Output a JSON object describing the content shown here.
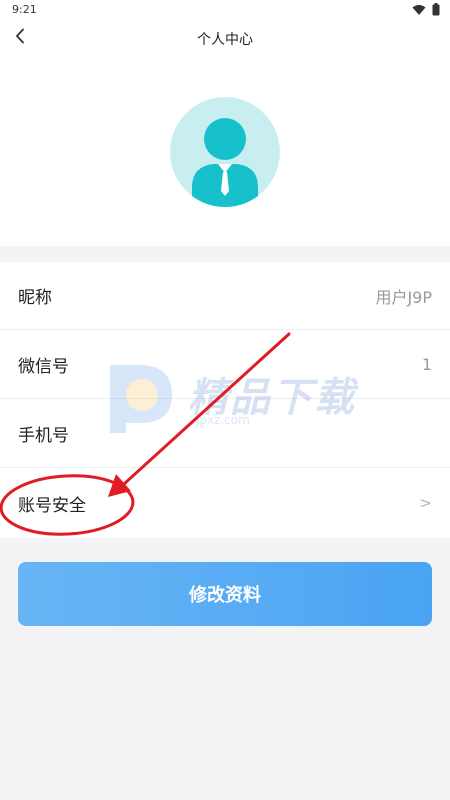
{
  "status_bar": {
    "time": "9:21"
  },
  "header": {
    "title": "个人中心"
  },
  "profile": {
    "rows": [
      {
        "label": "昵称",
        "value": "用户J9P"
      },
      {
        "label": "微信号",
        "value": "1"
      },
      {
        "label": "手机号",
        "value": ""
      },
      {
        "label": "账号安全",
        "value": ">"
      }
    ],
    "edit_button_label": "修改资料"
  },
  "watermark": {
    "brand": "精品下载",
    "site": "jpxz.com"
  },
  "colors": {
    "button_start": "#68b5f6",
    "button_end": "#4aa4f2",
    "avatar_bg": "#c9eef0",
    "avatar_figure": "#17c1cc",
    "annotation_red": "#e01b24"
  }
}
